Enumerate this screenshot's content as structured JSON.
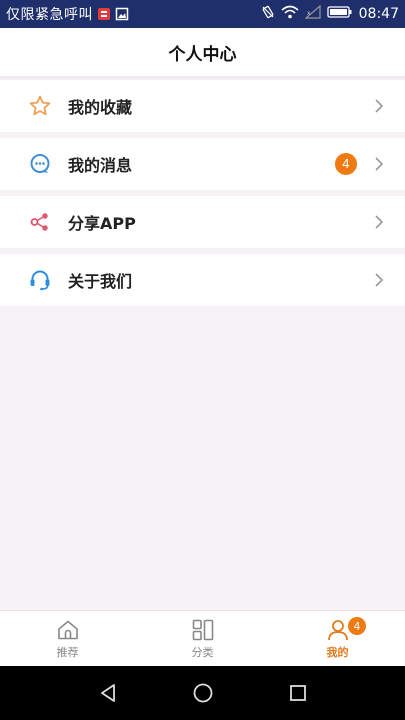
{
  "status_bar": {
    "carrier_text": "仅限紧急呼叫",
    "time": "08:47",
    "icons": [
      "alert-icon",
      "image-icon",
      "vibrate-icon",
      "wifi-icon",
      "signal-icon",
      "battery-icon"
    ]
  },
  "header": {
    "title": "个人中心"
  },
  "menu": {
    "items": [
      {
        "label": "我的收藏",
        "icon": "star-icon",
        "icon_color": "#f0a15a"
      },
      {
        "label": "我的消息",
        "icon": "chat-bubble-icon",
        "icon_color": "#3f8fd6",
        "badge": "4"
      },
      {
        "label": "分享APP",
        "icon": "share-icon",
        "icon_color": "#e0566f"
      },
      {
        "label": "关于我们",
        "icon": "headset-icon",
        "icon_color": "#2d8ee0"
      }
    ]
  },
  "tab_bar": {
    "tabs": [
      {
        "label": "推荐",
        "icon": "home-icon",
        "active": false
      },
      {
        "label": "分类",
        "icon": "grid-icon",
        "active": false
      },
      {
        "label": "我的",
        "icon": "person-icon",
        "active": true,
        "badge": "4"
      }
    ]
  },
  "colors": {
    "status_bar_bg": "#1e2f6b",
    "accent": "#f07a12",
    "page_bg": "#f7f2f6"
  }
}
